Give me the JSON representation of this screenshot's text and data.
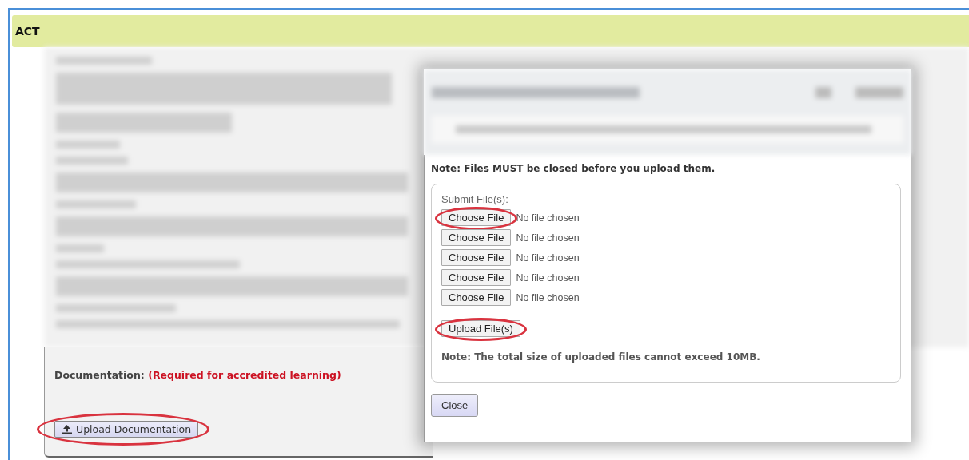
{
  "header": {
    "title": "ACT"
  },
  "documentation": {
    "label": "Documentation:",
    "note": "(Required for accredited learning)"
  },
  "upload_button": {
    "label": "Upload Documentation",
    "circled": true
  },
  "dialog": {
    "note": "Note: Files MUST be closed before you upload them.",
    "legend": "Submit File(s):",
    "files": [
      {
        "button": "Choose File",
        "status": "No file chosen",
        "circled": true
      },
      {
        "button": "Choose File",
        "status": "No file chosen",
        "circled": false
      },
      {
        "button": "Choose File",
        "status": "No file chosen",
        "circled": false
      },
      {
        "button": "Choose File",
        "status": "No file chosen",
        "circled": false
      },
      {
        "button": "Choose File",
        "status": "No file chosen",
        "circled": false
      }
    ],
    "upload_button": {
      "label": "Upload File(s)",
      "circled": true
    },
    "size_note": "Note: The total size of uploaded files cannot exceed 10MB.",
    "close_button": {
      "label": "Close"
    }
  }
}
